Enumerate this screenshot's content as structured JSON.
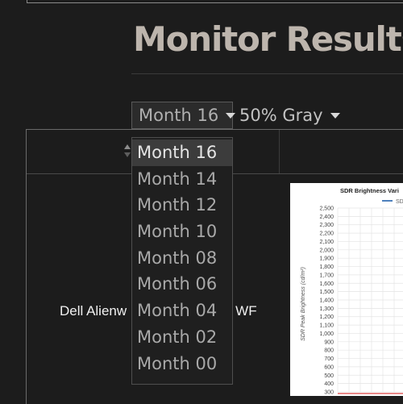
{
  "page": {
    "title": "Monitor Results"
  },
  "filters": {
    "period": {
      "selected": "Month 16"
    },
    "pattern": {
      "selected": "50% Gray"
    }
  },
  "dropdown": {
    "options": [
      "Month 16",
      "Month 14",
      "Month 12",
      "Month 10",
      "Month 08",
      "Month 06",
      "Month 04",
      "Month 02",
      "Month 00"
    ],
    "selected_index": 0
  },
  "table": {
    "row": {
      "product_name_visible": [
        "Dell Alienw",
        "WF"
      ]
    }
  },
  "chart_data": {
    "type": "line",
    "title": "SDR Brightness Vari",
    "legend": [
      "SD"
    ],
    "ylabel": "SDR Peak Brightness (cd/m²)",
    "yticks": [
      "2,500",
      "2,400",
      "2,300",
      "2,200",
      "2,100",
      "2,000",
      "1,900",
      "1,800",
      "1,700",
      "1,600",
      "1,500",
      "1,400",
      "1,300",
      "1,200",
      "1,100",
      "1,000",
      "900",
      "800",
      "700",
      "600",
      "500",
      "400",
      "300"
    ],
    "ylim": [
      300,
      2500
    ],
    "grid": true,
    "series": [
      {
        "values": [
          300
        ]
      }
    ],
    "colors": {
      "series": "#4f81bd",
      "baseline": "#e06060"
    }
  }
}
